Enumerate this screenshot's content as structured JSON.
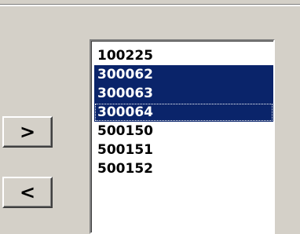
{
  "buttons": {
    "add_label": ">",
    "remove_label": "<"
  },
  "list": {
    "items": [
      {
        "label": "100225",
        "selected": false
      },
      {
        "label": "300062",
        "selected": true
      },
      {
        "label": "300063",
        "selected": true
      },
      {
        "label": "300064",
        "selected": true,
        "focused": true
      },
      {
        "label": "500150",
        "selected": false
      },
      {
        "label": "500151",
        "selected": false
      },
      {
        "label": "500152",
        "selected": false
      }
    ]
  },
  "colors": {
    "window_background": "#d4d0c8",
    "selection_background": "#0a246a",
    "selection_text": "#ffffff",
    "list_background": "#ffffff"
  }
}
